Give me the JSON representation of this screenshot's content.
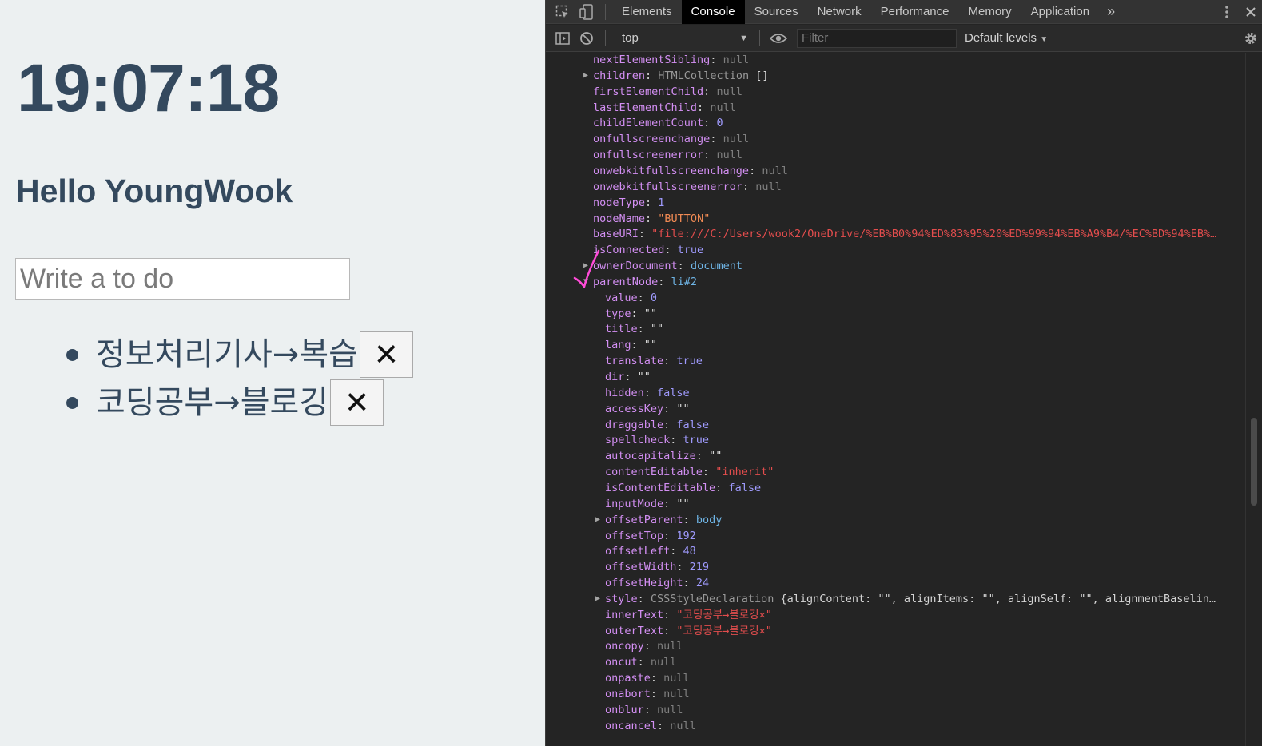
{
  "page": {
    "clock": "19:07:18",
    "greeting": "Hello YoungWook",
    "input_placeholder": "Write a to do",
    "todos": [
      {
        "text": "정보처리기사→복습",
        "delete_label": "✕"
      },
      {
        "text": "코딩공부→블로깅",
        "delete_label": "✕"
      }
    ],
    "text_color": "#34495e",
    "background": "#ecf0f1"
  },
  "devtools": {
    "tabs": [
      "Elements",
      "Console",
      "Sources",
      "Network",
      "Performance",
      "Memory",
      "Application"
    ],
    "active_tab": "Console",
    "more_tabs": "»",
    "context": "top",
    "filter_placeholder": "Filter",
    "levels": "Default levels",
    "icons": [
      "inspect-icon",
      "device-toggle-icon",
      "sidebar-toggle-icon",
      "clear-console-icon",
      "eye-icon",
      "settings-icon",
      "kebab-menu-icon",
      "close-icon"
    ],
    "lines": [
      {
        "arrow": false,
        "indent": 0,
        "key": "nextElementSibling",
        "val": "null",
        "cls": "null"
      },
      {
        "arrow": true,
        "indent": 0,
        "key": "children",
        "val": "HTMLCollection",
        "cls": "gray",
        "extra": "[]"
      },
      {
        "arrow": false,
        "indent": 0,
        "key": "firstElementChild",
        "val": "null",
        "cls": "null"
      },
      {
        "arrow": false,
        "indent": 0,
        "key": "lastElementChild",
        "val": "null",
        "cls": "null"
      },
      {
        "arrow": false,
        "indent": 0,
        "key": "childElementCount",
        "val": "0",
        "cls": "num"
      },
      {
        "arrow": false,
        "indent": 0,
        "key": "onfullscreenchange",
        "val": "null",
        "cls": "null"
      },
      {
        "arrow": false,
        "indent": 0,
        "key": "onfullscreenerror",
        "val": "null",
        "cls": "null"
      },
      {
        "arrow": false,
        "indent": 0,
        "key": "onwebkitfullscreenchange",
        "val": "null",
        "cls": "null"
      },
      {
        "arrow": false,
        "indent": 0,
        "key": "onwebkitfullscreenerror",
        "val": "null",
        "cls": "null"
      },
      {
        "arrow": false,
        "indent": 0,
        "key": "nodeType",
        "val": "1",
        "cls": "num"
      },
      {
        "arrow": false,
        "indent": 0,
        "key": "nodeName",
        "val": "\"BUTTON\"",
        "cls": "str"
      },
      {
        "arrow": false,
        "indent": 0,
        "key": "baseURI",
        "val": "\"file:///C:/Users/wook2/OneDrive/%EB%B0%94%ED%83%95%20%ED%99%94%EB%A9%B4/%EC%BD%94%EB%…",
        "cls": "str2"
      },
      {
        "arrow": false,
        "indent": 0,
        "key": "isConnected",
        "val": "true",
        "cls": "bool"
      },
      {
        "arrow": true,
        "indent": 0,
        "key": "ownerDocument",
        "val": "document",
        "cls": "obj"
      },
      {
        "arrow": true,
        "indent": 0,
        "key": "parentNode",
        "val": "li#2",
        "cls": "obj",
        "open": true
      },
      {
        "arrow": false,
        "indent": 1,
        "key": "value",
        "val": "0",
        "cls": "num"
      },
      {
        "arrow": false,
        "indent": 1,
        "key": "type",
        "val": "\"\"",
        "cls": "p"
      },
      {
        "arrow": false,
        "indent": 1,
        "key": "title",
        "val": "\"\"",
        "cls": "p"
      },
      {
        "arrow": false,
        "indent": 1,
        "key": "lang",
        "val": "\"\"",
        "cls": "p"
      },
      {
        "arrow": false,
        "indent": 1,
        "key": "translate",
        "val": "true",
        "cls": "bool"
      },
      {
        "arrow": false,
        "indent": 1,
        "key": "dir",
        "val": "\"\"",
        "cls": "p"
      },
      {
        "arrow": false,
        "indent": 1,
        "key": "hidden",
        "val": "false",
        "cls": "bool"
      },
      {
        "arrow": false,
        "indent": 1,
        "key": "accessKey",
        "val": "\"\"",
        "cls": "p"
      },
      {
        "arrow": false,
        "indent": 1,
        "key": "draggable",
        "val": "false",
        "cls": "bool"
      },
      {
        "arrow": false,
        "indent": 1,
        "key": "spellcheck",
        "val": "true",
        "cls": "bool"
      },
      {
        "arrow": false,
        "indent": 1,
        "key": "autocapitalize",
        "val": "\"\"",
        "cls": "p"
      },
      {
        "arrow": false,
        "indent": 1,
        "key": "contentEditable",
        "val": "\"inherit\"",
        "cls": "str2"
      },
      {
        "arrow": false,
        "indent": 1,
        "key": "isContentEditable",
        "val": "false",
        "cls": "bool"
      },
      {
        "arrow": false,
        "indent": 1,
        "key": "inputMode",
        "val": "\"\"",
        "cls": "p"
      },
      {
        "arrow": true,
        "indent": 1,
        "key": "offsetParent",
        "val": "body",
        "cls": "obj"
      },
      {
        "arrow": false,
        "indent": 1,
        "key": "offsetTop",
        "val": "192",
        "cls": "num"
      },
      {
        "arrow": false,
        "indent": 1,
        "key": "offsetLeft",
        "val": "48",
        "cls": "num"
      },
      {
        "arrow": false,
        "indent": 1,
        "key": "offsetWidth",
        "val": "219",
        "cls": "num"
      },
      {
        "arrow": false,
        "indent": 1,
        "key": "offsetHeight",
        "val": "24",
        "cls": "num"
      },
      {
        "arrow": true,
        "indent": 1,
        "key": "style",
        "val": "CSSStyleDeclaration",
        "cls": "gray",
        "extra": "{alignContent: \"\", alignItems: \"\", alignSelf: \"\", alignmentBaselin…"
      },
      {
        "arrow": false,
        "indent": 1,
        "key": "innerText",
        "val": "\"코딩공부→블로깅✕\"",
        "cls": "str2"
      },
      {
        "arrow": false,
        "indent": 1,
        "key": "outerText",
        "val": "\"코딩공부→블로깅✕\"",
        "cls": "str2"
      },
      {
        "arrow": false,
        "indent": 1,
        "key": "oncopy",
        "val": "null",
        "cls": "null"
      },
      {
        "arrow": false,
        "indent": 1,
        "key": "oncut",
        "val": "null",
        "cls": "null"
      },
      {
        "arrow": false,
        "indent": 1,
        "key": "onpaste",
        "val": "null",
        "cls": "null"
      },
      {
        "arrow": false,
        "indent": 1,
        "key": "onabort",
        "val": "null",
        "cls": "null"
      },
      {
        "arrow": false,
        "indent": 1,
        "key": "onblur",
        "val": "null",
        "cls": "null"
      },
      {
        "arrow": false,
        "indent": 1,
        "key": "oncancel",
        "val": "null",
        "cls": "null"
      }
    ]
  }
}
